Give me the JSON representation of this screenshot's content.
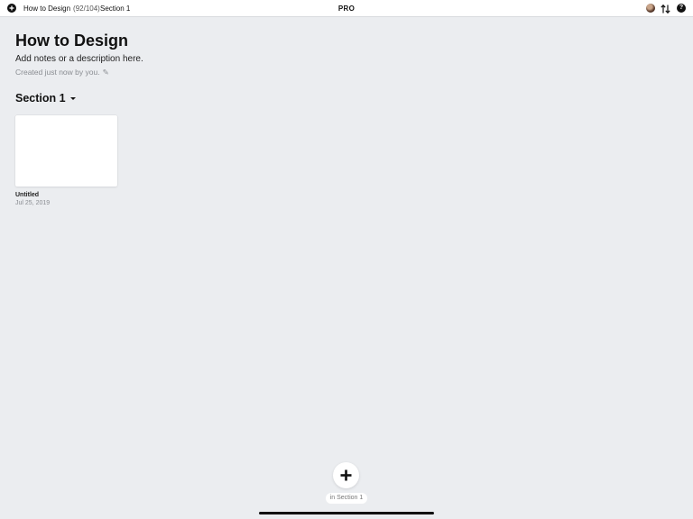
{
  "topbar": {
    "breadcrumb_title": "How to Design",
    "breadcrumb_count": "(92/104)",
    "breadcrumb_separator": "·",
    "breadcrumb_section": "Section 1",
    "center_label": "PRO"
  },
  "icons": {
    "back": "plus-circle-icon",
    "avatar": "user-avatar",
    "sort": "up-down-arrows-icon",
    "help": "question-mark-icon"
  },
  "document": {
    "title": "How to Design",
    "description": "Add notes or a description here.",
    "created": "Created just now by you.",
    "edit_glyph": "✎"
  },
  "section": {
    "title": "Section 1"
  },
  "cards": [
    {
      "title": "Untitled",
      "date": "Jul 25, 2019"
    }
  ],
  "add": {
    "caption": "in Section 1"
  },
  "help_glyph": "?"
}
